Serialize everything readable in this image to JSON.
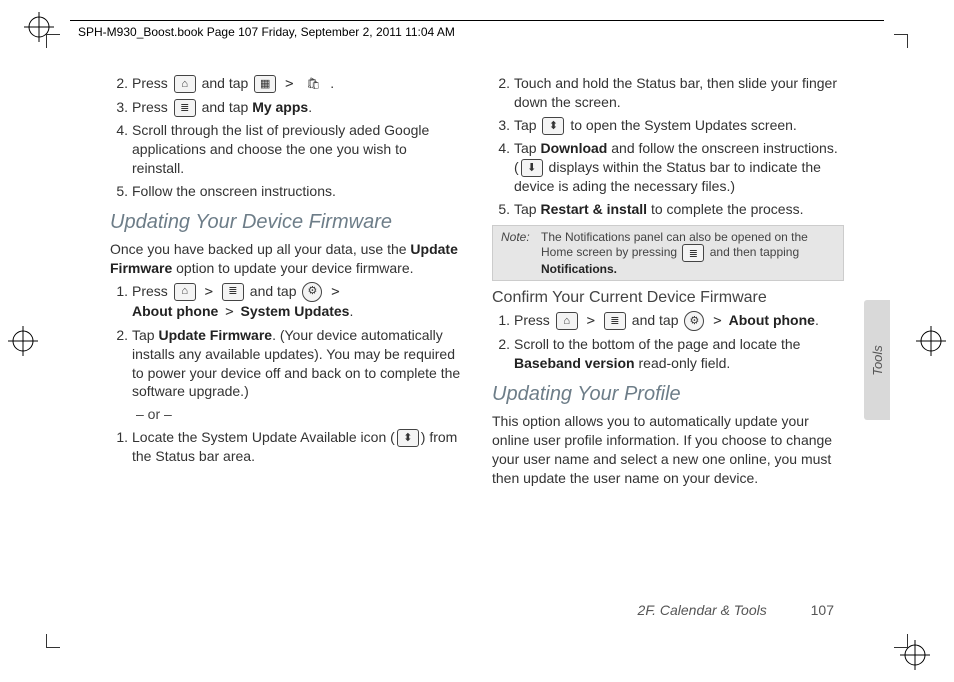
{
  "header": "SPH-M930_Boost.book  Page 107  Friday, September 2, 2011  11:04 AM",
  "side_tab": "Tools",
  "footer_section": "2F. Calendar & Tools",
  "footer_page": "107",
  "left": {
    "step2": {
      "n": "2.",
      "pre": "Press ",
      "mid": " and tap ",
      "end": " ."
    },
    "step3": {
      "n": "3.",
      "pre": "Press ",
      "mid": " and tap ",
      "bold": "My apps",
      "end": "."
    },
    "step4": {
      "n": "4.",
      "text": "Scroll through the list of previously aded Google applications and choose the one you wish to reinstall."
    },
    "step5": {
      "n": "5.",
      "text": "Follow the onscreen instructions."
    },
    "h2": "Updating Your Device Firmware",
    "intro1": "Once you have backed up all your data, use the ",
    "intro_bold": "Update Firmware",
    "intro2": " option to update your device firmware.",
    "f_step1": {
      "n": "1.",
      "pre": "Press ",
      "mid1": " and tap ",
      "line2a": "About phone",
      "line2b": "System Updates",
      "end": "."
    },
    "f_step2": {
      "n": "2.",
      "pre": "Tap ",
      "bold": "Update Firmware",
      "rest": ". (Your device automatically installs any available updates). You may be required to power your device off and back on to complete the software upgrade.)"
    },
    "or": "– or –",
    "alt_step1": {
      "n": "1.",
      "pre": "Locate the System Update Available icon (",
      "post": ") from the Status bar area."
    }
  },
  "right": {
    "r_step2": {
      "n": "2.",
      "text": "Touch and hold the Status bar, then slide your finger down the screen."
    },
    "r_step3": {
      "n": "3.",
      "pre": "Tap ",
      "post": " to open the System Updates screen."
    },
    "r_step4": {
      "n": "4.",
      "pre": "Tap ",
      "bold": "Download",
      "mid": " and follow the onscreen instructions. (",
      "post": " displays within the Status bar to indicate the device is ading the necessary files.)"
    },
    "r_step5": {
      "n": "5.",
      "pre": "Tap ",
      "bold": "Restart & install",
      "post": " to complete the process."
    },
    "note_label": "Note:",
    "note1": "The Notifications panel can also be opened on the Home screen by pressing ",
    "note2": " and then tapping ",
    "note_bold": "Notifications.",
    "h3": "Confirm Your Current Device Firmware",
    "c_step1": {
      "n": "1.",
      "pre": "Press ",
      "mid": " and tap ",
      "bold": "About phone",
      "end": "."
    },
    "c_step2": {
      "n": "2.",
      "pre": "Scroll to the bottom of the page and locate the ",
      "bold": "Baseband version",
      "post": " read-only field."
    },
    "h2": "Updating Your Profile",
    "p_intro": "This option allows you to automatically update your online user profile information. If you choose to change your user name and select a new one online, you must then update the user name on your device."
  }
}
